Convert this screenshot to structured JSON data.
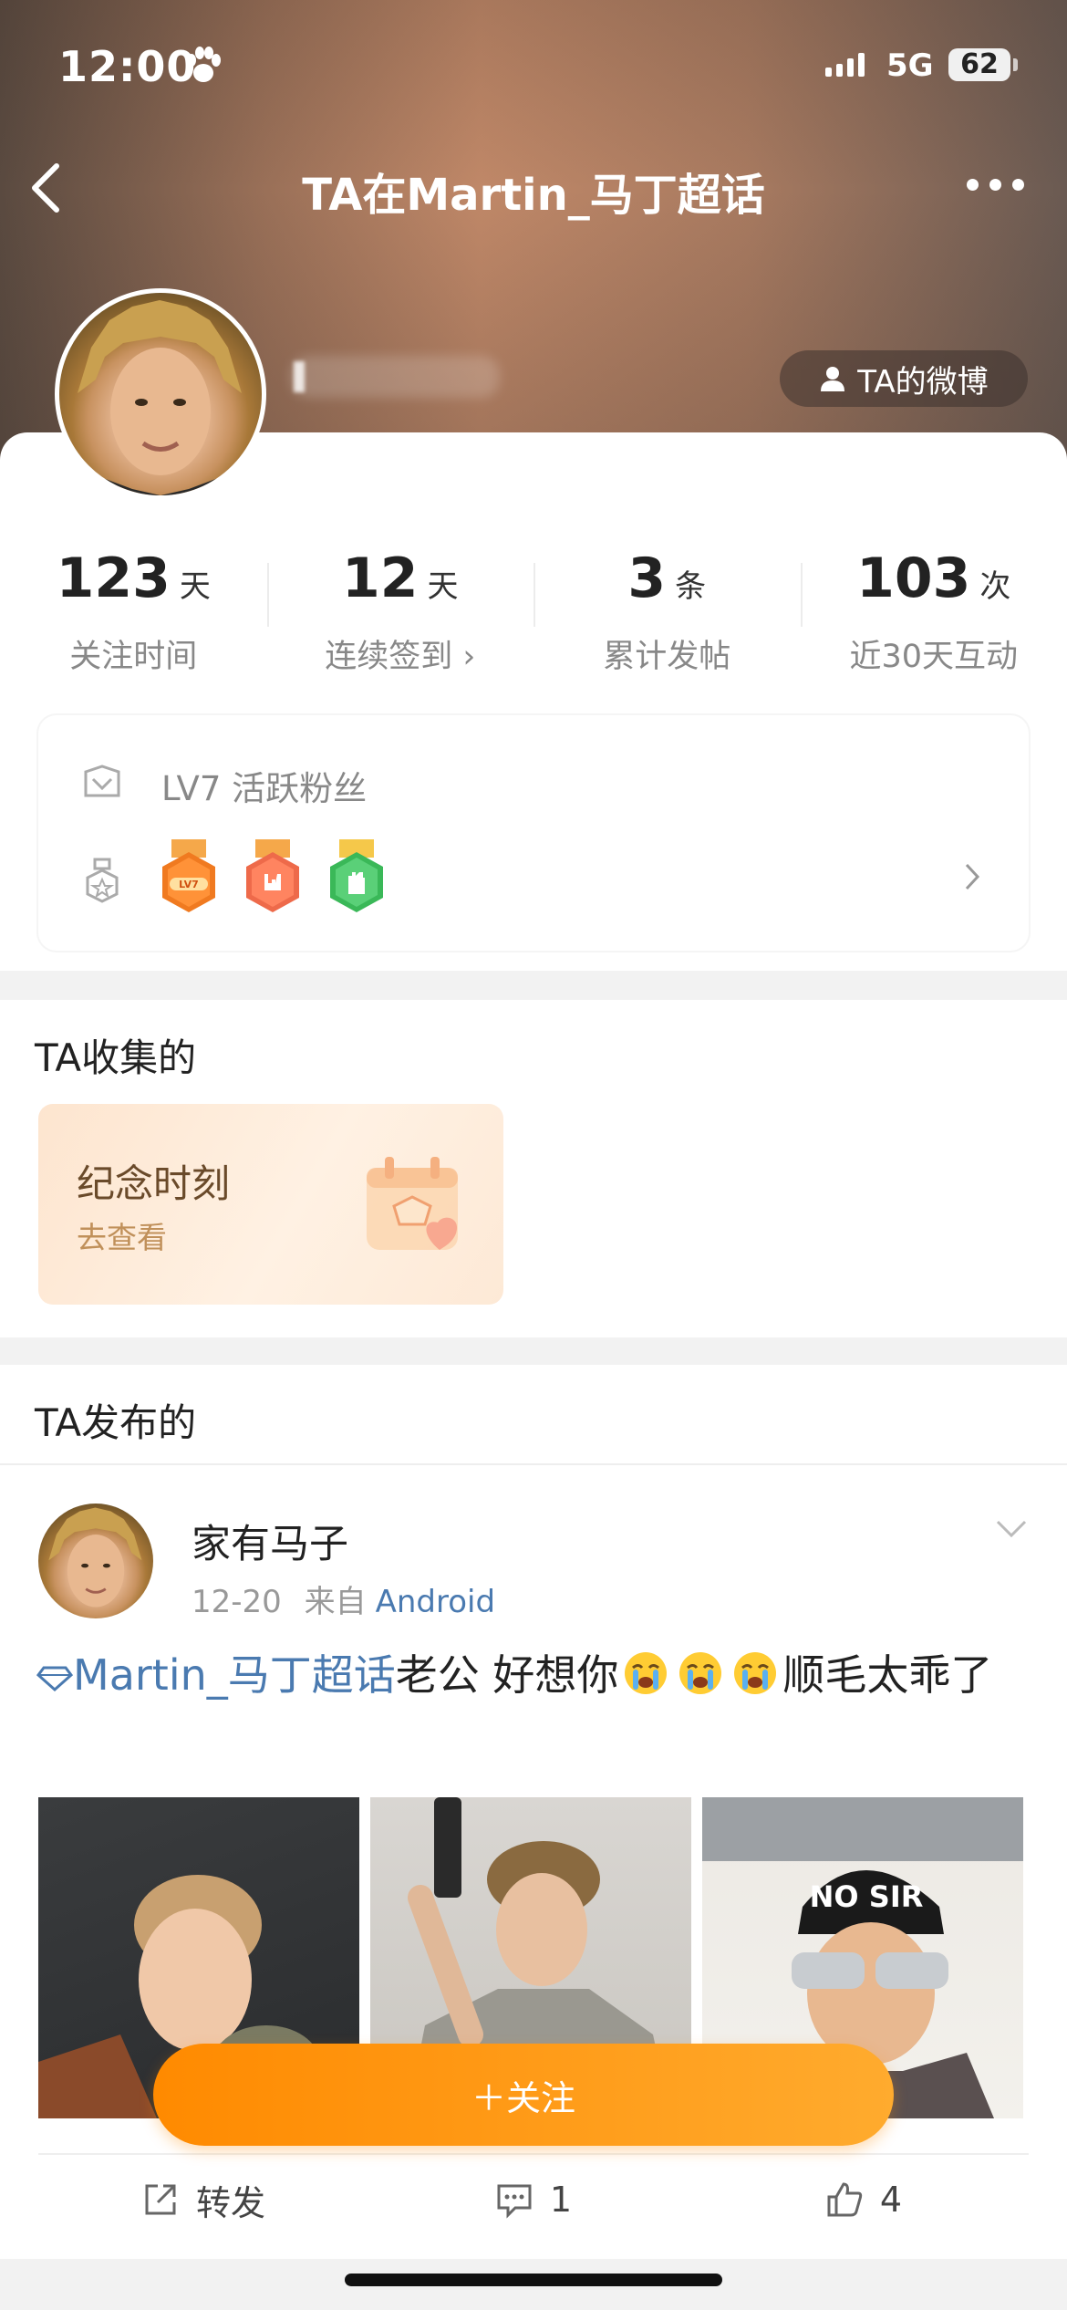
{
  "status_bar": {
    "time": "12:00",
    "network": "5G",
    "battery": "62"
  },
  "nav": {
    "title": "TA在Martin_马丁超话"
  },
  "profile": {
    "weibo_button": "TA的微博"
  },
  "stats": [
    {
      "value": "123",
      "unit": "天",
      "label": "关注时间"
    },
    {
      "value": "12",
      "unit": "天",
      "label": "连续签到 ›"
    },
    {
      "value": "3",
      "unit": "条",
      "label": "累计发帖"
    },
    {
      "value": "103",
      "unit": "次",
      "label": "近30天互动"
    }
  ],
  "level": {
    "text": "LV7 活跃粉丝",
    "badge1": "LV7"
  },
  "collect": {
    "title": "TA收集的",
    "card_title": "纪念时刻",
    "card_sub": "去查看"
  },
  "posts": {
    "title": "TA发布的",
    "author": "家有马子",
    "date": "12-20",
    "source_prefix": "来自",
    "source": "Android",
    "topic": "Martin_马丁超话",
    "text_a": "老公 好想你",
    "text_b": "顺毛太乖了",
    "photo3_caption": "NO SIR",
    "actions": {
      "repost": "转发",
      "comment": "1",
      "like": "4"
    }
  },
  "follow_button": "＋关注",
  "colors": {
    "accent": "#ff8a00",
    "link": "#4a7ab0"
  }
}
